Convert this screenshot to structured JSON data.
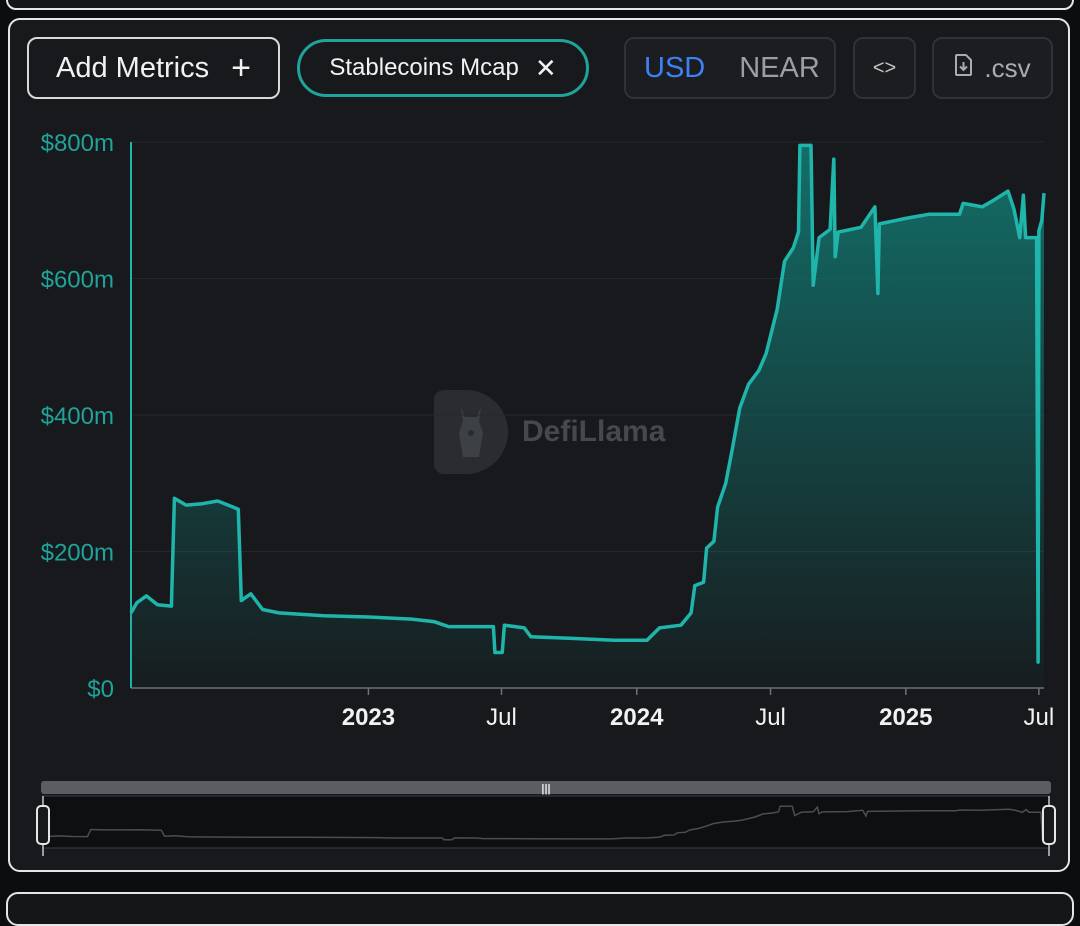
{
  "toolbar": {
    "add_metrics_label": "Add Metrics",
    "plus_symbol": "+",
    "chip_label": "Stablecoins Mcap",
    "chip_close": "✕",
    "currency_active": "USD",
    "currency_inactive": "NEAR",
    "embed_label": "<>",
    "csv_label": ".csv"
  },
  "watermark": {
    "text": "DefiLlama"
  },
  "colors": {
    "series": "#1fb5aa",
    "area_top": "#137d76",
    "accent_border": "#1fa39a",
    "active_toggle": "#3b82f6"
  },
  "chart_data": {
    "type": "area",
    "title": "",
    "xlabel": "",
    "ylabel": "",
    "ylim": [
      0,
      800
    ],
    "y_unit": "$m",
    "y_ticks": [
      0,
      200,
      400,
      600,
      800
    ],
    "y_tick_labels": [
      "$0",
      "$200m",
      "$400m",
      "$600m",
      "$800m"
    ],
    "x_range": [
      "2022-02-12",
      "2025-07-08"
    ],
    "x_ticks": [
      {
        "date": "2023-01-01",
        "label": "2023",
        "major": true
      },
      {
        "date": "2023-07-01",
        "label": "Jul",
        "major": false
      },
      {
        "date": "2024-01-01",
        "label": "2024",
        "major": true
      },
      {
        "date": "2024-07-01",
        "label": "Jul",
        "major": false
      },
      {
        "date": "2025-01-01",
        "label": "2025",
        "major": true
      },
      {
        "date": "2025-07-01",
        "label": "Jul",
        "major": false
      }
    ],
    "grid": true,
    "series": [
      {
        "name": "Stablecoins Mcap",
        "points": [
          [
            "2022-02-12",
            110
          ],
          [
            "2022-02-20",
            125
          ],
          [
            "2022-03-05",
            135
          ],
          [
            "2022-03-20",
            122
          ],
          [
            "2022-04-08",
            120
          ],
          [
            "2022-04-12",
            278
          ],
          [
            "2022-04-28",
            268
          ],
          [
            "2022-05-20",
            270
          ],
          [
            "2022-06-10",
            274
          ],
          [
            "2022-07-01",
            265
          ],
          [
            "2022-07-08",
            262
          ],
          [
            "2022-07-12",
            128
          ],
          [
            "2022-07-25",
            138
          ],
          [
            "2022-08-10",
            115
          ],
          [
            "2022-09-01",
            110
          ],
          [
            "2022-11-01",
            106
          ],
          [
            "2023-01-01",
            104
          ],
          [
            "2023-03-01",
            101
          ],
          [
            "2023-04-01",
            97
          ],
          [
            "2023-04-20",
            90
          ],
          [
            "2023-06-20",
            90
          ],
          [
            "2023-06-22",
            52
          ],
          [
            "2023-07-02",
            52
          ],
          [
            "2023-07-05",
            92
          ],
          [
            "2023-08-01",
            88
          ],
          [
            "2023-08-10",
            75
          ],
          [
            "2023-10-01",
            73
          ],
          [
            "2023-12-01",
            70
          ],
          [
            "2024-01-15",
            70
          ],
          [
            "2024-02-01",
            88
          ],
          [
            "2024-03-01",
            92
          ],
          [
            "2024-03-15",
            110
          ],
          [
            "2024-03-20",
            150
          ],
          [
            "2024-04-01",
            155
          ],
          [
            "2024-04-05",
            205
          ],
          [
            "2024-04-15",
            215
          ],
          [
            "2024-04-20",
            265
          ],
          [
            "2024-05-01",
            300
          ],
          [
            "2024-05-10",
            350
          ],
          [
            "2024-05-20",
            410
          ],
          [
            "2024-06-01",
            445
          ],
          [
            "2024-06-15",
            465
          ],
          [
            "2024-06-25",
            490
          ],
          [
            "2024-07-10",
            555
          ],
          [
            "2024-07-20",
            625
          ],
          [
            "2024-08-01",
            645
          ],
          [
            "2024-08-08",
            668
          ],
          [
            "2024-08-10",
            795
          ],
          [
            "2024-08-25",
            795
          ],
          [
            "2024-08-28",
            590
          ],
          [
            "2024-09-05",
            660
          ],
          [
            "2024-09-20",
            672
          ],
          [
            "2024-09-25",
            775
          ],
          [
            "2024-09-27",
            632
          ],
          [
            "2024-10-01",
            668
          ],
          [
            "2024-11-01",
            675
          ],
          [
            "2024-11-20",
            705
          ],
          [
            "2024-11-24",
            578
          ],
          [
            "2024-11-26",
            680
          ],
          [
            "2025-01-01",
            688
          ],
          [
            "2025-02-01",
            694
          ],
          [
            "2025-03-15",
            694
          ],
          [
            "2025-03-20",
            710
          ],
          [
            "2025-04-15",
            705
          ],
          [
            "2025-05-01",
            715
          ],
          [
            "2025-05-20",
            728
          ],
          [
            "2025-05-28",
            702
          ],
          [
            "2025-06-05",
            660
          ],
          [
            "2025-06-10",
            722
          ],
          [
            "2025-06-13",
            660
          ],
          [
            "2025-06-28",
            660
          ],
          [
            "2025-06-30",
            38
          ],
          [
            "2025-07-01",
            670
          ],
          [
            "2025-07-05",
            685
          ],
          [
            "2025-07-08",
            725
          ]
        ]
      }
    ]
  }
}
